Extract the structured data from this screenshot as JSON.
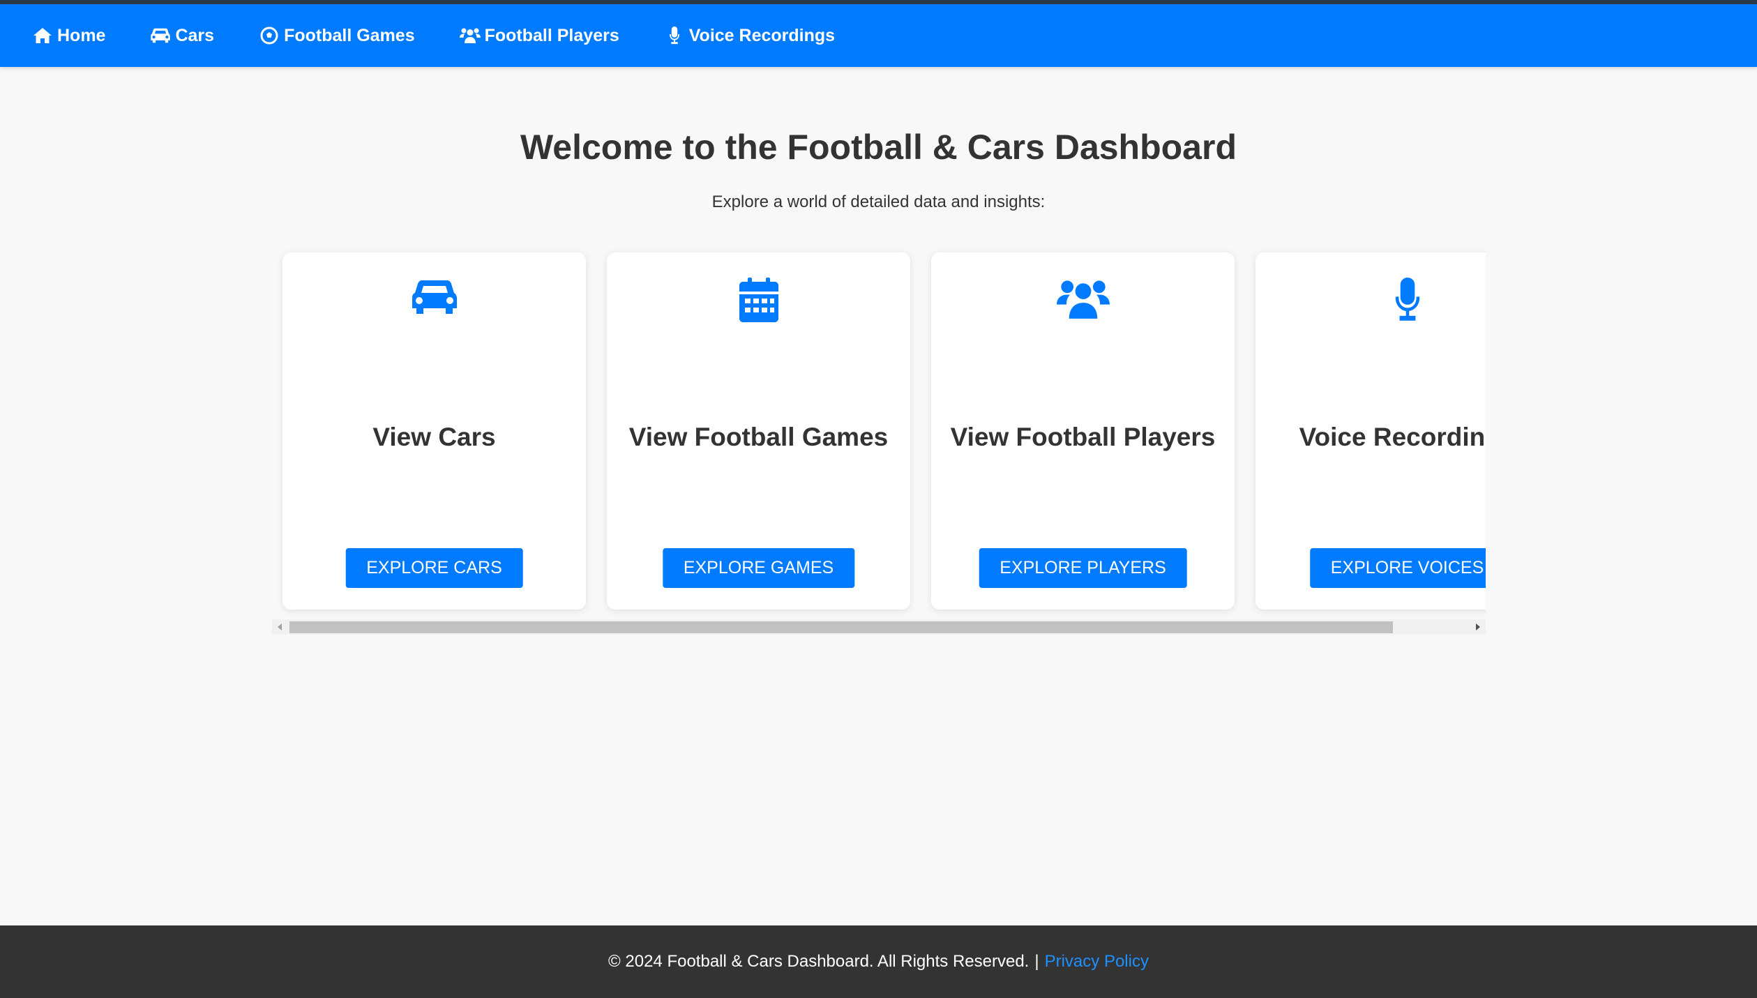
{
  "nav": {
    "items": [
      {
        "label": "Home",
        "icon": "home-icon"
      },
      {
        "label": "Cars",
        "icon": "car-icon"
      },
      {
        "label": "Football Games",
        "icon": "football-icon"
      },
      {
        "label": "Football Players",
        "icon": "users-icon"
      },
      {
        "label": "Voice Recordings",
        "icon": "microphone-icon"
      }
    ]
  },
  "hero": {
    "title": "Welcome to the Football & Cars Dashboard",
    "subtitle": "Explore a world of detailed data and insights:"
  },
  "cards": [
    {
      "title": "View Cars",
      "button": "EXPLORE CARS",
      "icon": "car-icon"
    },
    {
      "title": "View Football Games",
      "button": "EXPLORE GAMES",
      "icon": "calendar-icon"
    },
    {
      "title": "View Football Players",
      "button": "EXPLORE PLAYERS",
      "icon": "users-icon"
    },
    {
      "title": "Voice Recordings",
      "button": "EXPLORE VOICES",
      "icon": "microphone-icon"
    }
  ],
  "footer": {
    "copyright": "© 2024 Football & Cars Dashboard. All Rights Reserved.",
    "separator": "|",
    "privacy_link": "Privacy Policy"
  },
  "colors": {
    "primary": "#007bff",
    "footer_bg": "#333333",
    "page_bg": "#f8f8f8",
    "link": "#1e90ff"
  }
}
